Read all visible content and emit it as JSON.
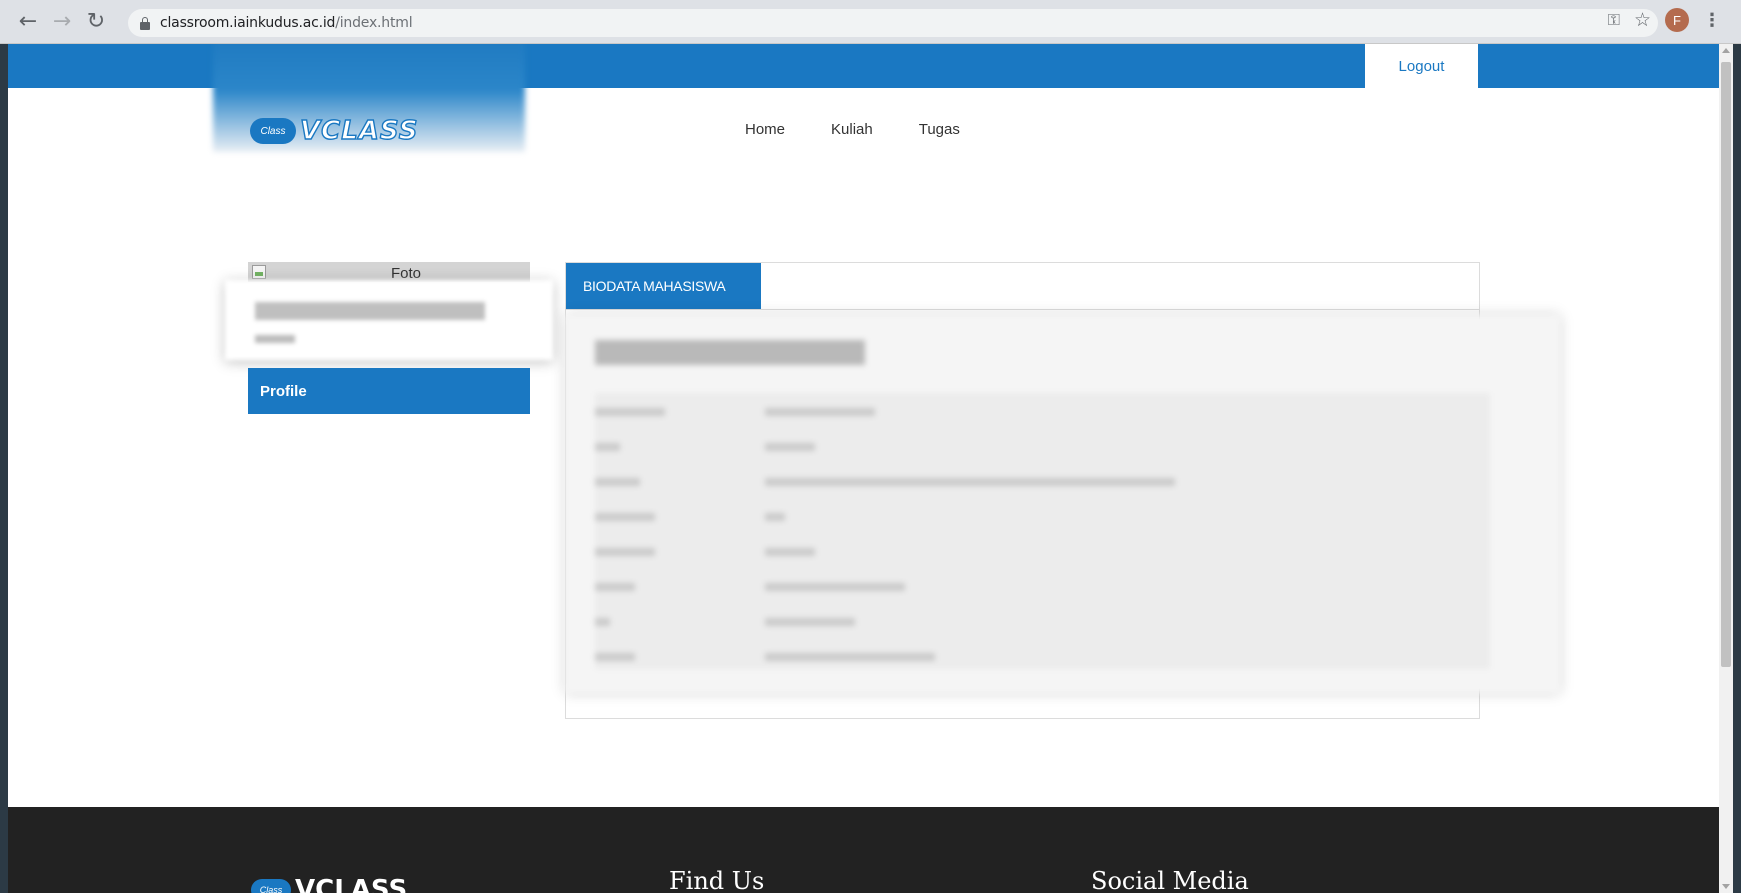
{
  "browser": {
    "url_host": "classroom.iainkudus.ac.id",
    "url_path": "/index.html",
    "profile_initial": "F"
  },
  "topbar": {
    "logout_label": "Logout"
  },
  "brand": {
    "logo_cloud_text": "Class",
    "logo_text": "VCLASS"
  },
  "nav": {
    "items": [
      {
        "label": "Home"
      },
      {
        "label": "Kuliah"
      },
      {
        "label": "Tugas"
      }
    ]
  },
  "sidebar": {
    "photo_alt": "Foto",
    "menu": [
      {
        "label": "Profile"
      }
    ]
  },
  "panel": {
    "tab_label": "BIODATA MAHASISWA"
  },
  "footer": {
    "logo_text": "VCLASS",
    "find_us": "Find Us",
    "social_media": "Social Media"
  },
  "colors": {
    "accent": "#1a78c2",
    "footer_bg": "#222222"
  }
}
